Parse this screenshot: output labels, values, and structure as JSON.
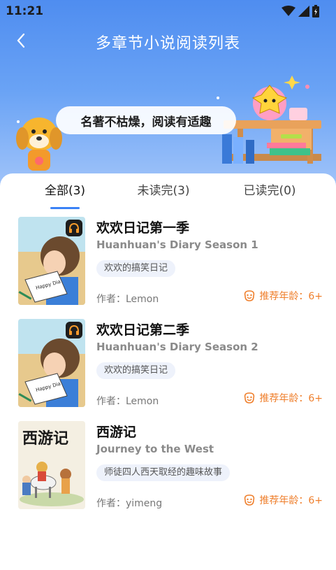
{
  "status_bar": {
    "time": "11:21",
    "icons": [
      "wifi-icon",
      "signal-icon",
      "battery-icon"
    ]
  },
  "nav": {
    "title": "多章节小说阅读列表",
    "back_icon": "back-chevron-icon"
  },
  "banner": {
    "slogan": "名著不枯燥，阅读有适趣"
  },
  "tabs": [
    {
      "label": "全部(3)",
      "active": true
    },
    {
      "label": "未读完(3)",
      "active": false
    },
    {
      "label": "已读完(0)",
      "active": false
    }
  ],
  "books": [
    {
      "title": "欢欢日记第一季",
      "subtitle": "Huanhuan's Diary Season 1",
      "tag": "欢欢的搞笑日记",
      "author": "作者：Lemon",
      "age": "推荐年龄：6+",
      "cover_text": "Happy Dia",
      "has_audio": true
    },
    {
      "title": "欢欢日记第二季",
      "subtitle": "Huanhuan's Diary Season 2",
      "tag": "欢欢的搞笑日记",
      "author": "作者：Lemon",
      "age": "推荐年龄：6+",
      "cover_text": "Happy Dia",
      "has_audio": true
    },
    {
      "title": "西游记",
      "subtitle": "Journey to the West",
      "tag": "师徒四人西天取经的趣味故事",
      "author": "作者：yimeng",
      "age": "推荐年龄：6+",
      "cover_text": "西游记",
      "has_audio": false
    }
  ],
  "colors": {
    "accent": "#3b82f6",
    "age": "#ef7f2c",
    "header_top": "#4f8df0"
  }
}
